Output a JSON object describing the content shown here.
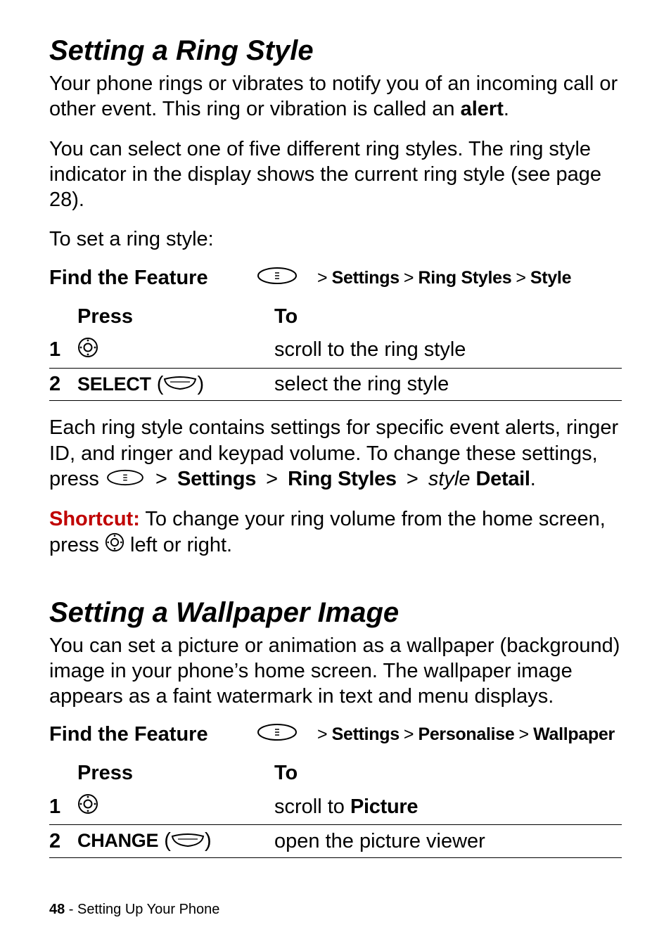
{
  "section1": {
    "title": "Setting a Ring Style",
    "para1_a": "Your phone rings or vibrates to notify you of an incoming call or other event. This ring or vibration is called an ",
    "para1_b": "alert",
    "para1_c": ".",
    "para2": "You can select one of five different ring styles. The ring style indicator in the display shows the current ring style (see page 28).",
    "para3": "To set a ring style:",
    "feature_label": "Find the Feature",
    "path": [
      "Settings",
      "Ring Styles",
      "Style"
    ],
    "table": {
      "head_press": "Press",
      "head_to": "To",
      "rows": [
        {
          "n": "1",
          "press_kind": "nav-icon",
          "press_label": "",
          "to": "scroll to the ring style"
        },
        {
          "n": "2",
          "press_kind": "softkey",
          "press_label": "SELECT",
          "to": "select the ring style"
        }
      ]
    },
    "after1_a": "Each ring style contains settings for specific event alerts, ringer ID, and ringer and keypad volume. To change these settings, press ",
    "after1_b_parts": [
      "Settings",
      "Ring Styles"
    ],
    "after1_c": " > ",
    "after1_style_word": "style",
    "after1_detail": "Detail",
    "shortcut_label": "Shortcut:",
    "shortcut_text_a": " To change your ring volume from the home screen, press ",
    "shortcut_text_b": " left or right."
  },
  "section2": {
    "title": "Setting a Wallpaper Image",
    "para1": "You can set a picture or animation as a wallpaper (background) image in your phone’s home screen. The wallpaper image appears as a faint watermark in text and menu displays.",
    "feature_label": "Find the Feature",
    "path": [
      "Settings",
      "Personalise",
      "Wallpaper"
    ],
    "table": {
      "head_press": "Press",
      "head_to": "To",
      "rows": [
        {
          "n": "1",
          "press_kind": "nav-icon",
          "press_label": "",
          "to_a": "scroll to ",
          "to_b": "Picture"
        },
        {
          "n": "2",
          "press_kind": "softkey",
          "press_label": "CHANGE",
          "to": "open the picture viewer"
        }
      ]
    }
  },
  "footer": {
    "page": "48",
    "sep": " - ",
    "section": "Setting Up Your Phone"
  },
  "glyphs": {
    "gt": ">"
  }
}
